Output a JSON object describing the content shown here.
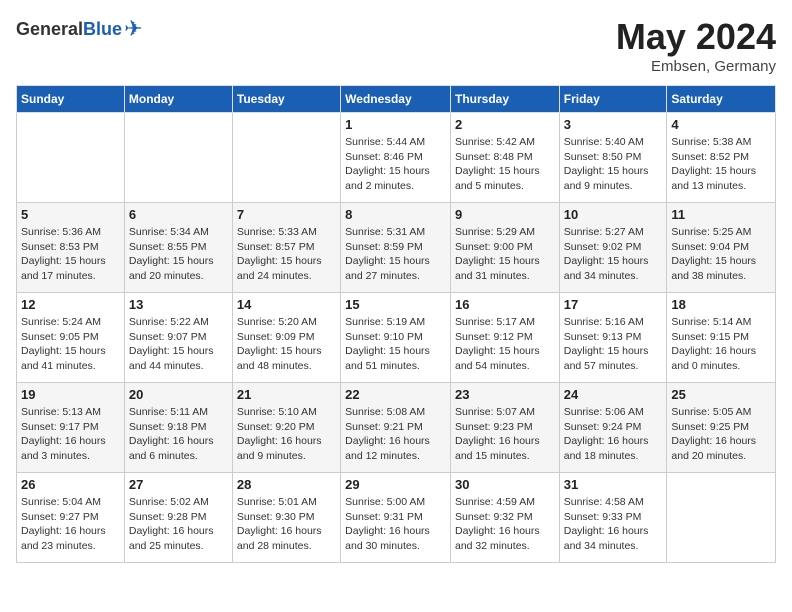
{
  "header": {
    "logo_general": "General",
    "logo_blue": "Blue",
    "month_title": "May 2024",
    "subtitle": "Embsen, Germany"
  },
  "days_of_week": [
    "Sunday",
    "Monday",
    "Tuesday",
    "Wednesday",
    "Thursday",
    "Friday",
    "Saturday"
  ],
  "weeks": [
    [
      {
        "day": "",
        "info": ""
      },
      {
        "day": "",
        "info": ""
      },
      {
        "day": "",
        "info": ""
      },
      {
        "day": "1",
        "info": "Sunrise: 5:44 AM\nSunset: 8:46 PM\nDaylight: 15 hours\nand 2 minutes."
      },
      {
        "day": "2",
        "info": "Sunrise: 5:42 AM\nSunset: 8:48 PM\nDaylight: 15 hours\nand 5 minutes."
      },
      {
        "day": "3",
        "info": "Sunrise: 5:40 AM\nSunset: 8:50 PM\nDaylight: 15 hours\nand 9 minutes."
      },
      {
        "day": "4",
        "info": "Sunrise: 5:38 AM\nSunset: 8:52 PM\nDaylight: 15 hours\nand 13 minutes."
      }
    ],
    [
      {
        "day": "5",
        "info": "Sunrise: 5:36 AM\nSunset: 8:53 PM\nDaylight: 15 hours\nand 17 minutes."
      },
      {
        "day": "6",
        "info": "Sunrise: 5:34 AM\nSunset: 8:55 PM\nDaylight: 15 hours\nand 20 minutes."
      },
      {
        "day": "7",
        "info": "Sunrise: 5:33 AM\nSunset: 8:57 PM\nDaylight: 15 hours\nand 24 minutes."
      },
      {
        "day": "8",
        "info": "Sunrise: 5:31 AM\nSunset: 8:59 PM\nDaylight: 15 hours\nand 27 minutes."
      },
      {
        "day": "9",
        "info": "Sunrise: 5:29 AM\nSunset: 9:00 PM\nDaylight: 15 hours\nand 31 minutes."
      },
      {
        "day": "10",
        "info": "Sunrise: 5:27 AM\nSunset: 9:02 PM\nDaylight: 15 hours\nand 34 minutes."
      },
      {
        "day": "11",
        "info": "Sunrise: 5:25 AM\nSunset: 9:04 PM\nDaylight: 15 hours\nand 38 minutes."
      }
    ],
    [
      {
        "day": "12",
        "info": "Sunrise: 5:24 AM\nSunset: 9:05 PM\nDaylight: 15 hours\nand 41 minutes."
      },
      {
        "day": "13",
        "info": "Sunrise: 5:22 AM\nSunset: 9:07 PM\nDaylight: 15 hours\nand 44 minutes."
      },
      {
        "day": "14",
        "info": "Sunrise: 5:20 AM\nSunset: 9:09 PM\nDaylight: 15 hours\nand 48 minutes."
      },
      {
        "day": "15",
        "info": "Sunrise: 5:19 AM\nSunset: 9:10 PM\nDaylight: 15 hours\nand 51 minutes."
      },
      {
        "day": "16",
        "info": "Sunrise: 5:17 AM\nSunset: 9:12 PM\nDaylight: 15 hours\nand 54 minutes."
      },
      {
        "day": "17",
        "info": "Sunrise: 5:16 AM\nSunset: 9:13 PM\nDaylight: 15 hours\nand 57 minutes."
      },
      {
        "day": "18",
        "info": "Sunrise: 5:14 AM\nSunset: 9:15 PM\nDaylight: 16 hours\nand 0 minutes."
      }
    ],
    [
      {
        "day": "19",
        "info": "Sunrise: 5:13 AM\nSunset: 9:17 PM\nDaylight: 16 hours\nand 3 minutes."
      },
      {
        "day": "20",
        "info": "Sunrise: 5:11 AM\nSunset: 9:18 PM\nDaylight: 16 hours\nand 6 minutes."
      },
      {
        "day": "21",
        "info": "Sunrise: 5:10 AM\nSunset: 9:20 PM\nDaylight: 16 hours\nand 9 minutes."
      },
      {
        "day": "22",
        "info": "Sunrise: 5:08 AM\nSunset: 9:21 PM\nDaylight: 16 hours\nand 12 minutes."
      },
      {
        "day": "23",
        "info": "Sunrise: 5:07 AM\nSunset: 9:23 PM\nDaylight: 16 hours\nand 15 minutes."
      },
      {
        "day": "24",
        "info": "Sunrise: 5:06 AM\nSunset: 9:24 PM\nDaylight: 16 hours\nand 18 minutes."
      },
      {
        "day": "25",
        "info": "Sunrise: 5:05 AM\nSunset: 9:25 PM\nDaylight: 16 hours\nand 20 minutes."
      }
    ],
    [
      {
        "day": "26",
        "info": "Sunrise: 5:04 AM\nSunset: 9:27 PM\nDaylight: 16 hours\nand 23 minutes."
      },
      {
        "day": "27",
        "info": "Sunrise: 5:02 AM\nSunset: 9:28 PM\nDaylight: 16 hours\nand 25 minutes."
      },
      {
        "day": "28",
        "info": "Sunrise: 5:01 AM\nSunset: 9:30 PM\nDaylight: 16 hours\nand 28 minutes."
      },
      {
        "day": "29",
        "info": "Sunrise: 5:00 AM\nSunset: 9:31 PM\nDaylight: 16 hours\nand 30 minutes."
      },
      {
        "day": "30",
        "info": "Sunrise: 4:59 AM\nSunset: 9:32 PM\nDaylight: 16 hours\nand 32 minutes."
      },
      {
        "day": "31",
        "info": "Sunrise: 4:58 AM\nSunset: 9:33 PM\nDaylight: 16 hours\nand 34 minutes."
      },
      {
        "day": "",
        "info": ""
      }
    ]
  ]
}
